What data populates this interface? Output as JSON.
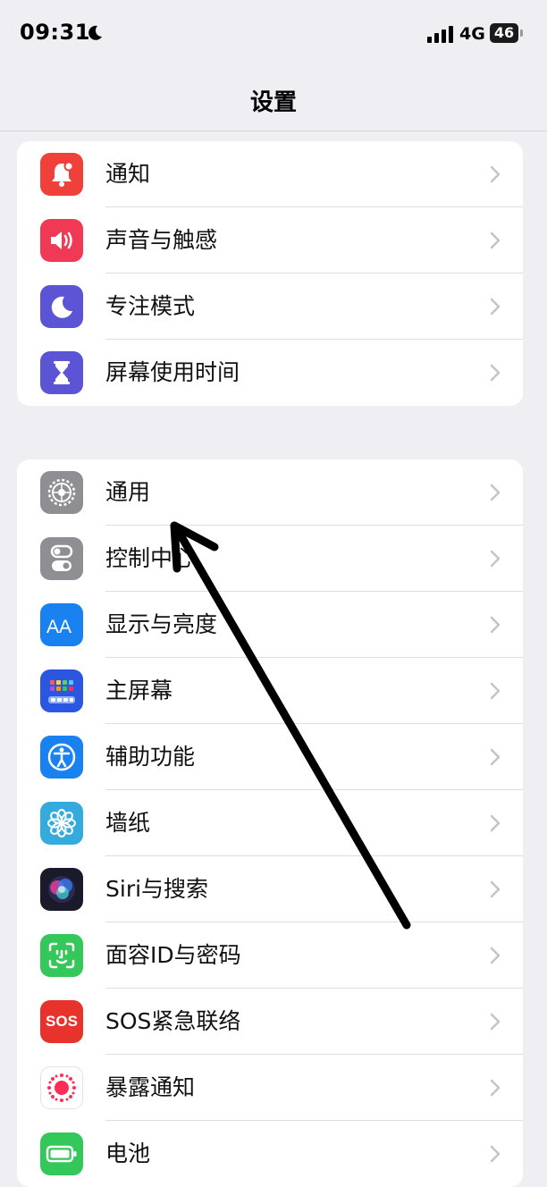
{
  "status": {
    "time": "09:31",
    "network": "4G",
    "battery": "46"
  },
  "nav": {
    "title": "设置"
  },
  "group1": [
    {
      "label": "通知",
      "icon": "notification-bell-icon",
      "color": "#f0403a"
    },
    {
      "label": "声音与触感",
      "icon": "speaker-icon",
      "color": "#f03a55"
    },
    {
      "label": "专注模式",
      "icon": "moon-icon",
      "color": "#5b55d6"
    },
    {
      "label": "屏幕使用时间",
      "icon": "hourglass-icon",
      "color": "#5b55d6"
    }
  ],
  "group2": [
    {
      "label": "通用",
      "icon": "gear-icon",
      "color": "#8e8e93"
    },
    {
      "label": "控制中心",
      "icon": "toggles-icon",
      "color": "#8e8e93"
    },
    {
      "label": "显示与亮度",
      "icon": "text-size-icon",
      "color": "#1a82f0"
    },
    {
      "label": "主屏幕",
      "icon": "home-grid-icon",
      "color": "#2a56e0"
    },
    {
      "label": "辅助功能",
      "icon": "accessibility-icon",
      "color": "#1a82f0"
    },
    {
      "label": "墙纸",
      "icon": "flower-icon",
      "color": "#35aadc"
    },
    {
      "label": "Siri与搜索",
      "icon": "siri-icon",
      "color": "#1a1a2a"
    },
    {
      "label": "面容ID与密码",
      "icon": "face-id-icon",
      "color": "#34c759"
    },
    {
      "label": "SOS紧急联络",
      "icon": "sos-icon",
      "color": "#e8332c"
    },
    {
      "label": "暴露通知",
      "icon": "exposure-icon",
      "color": "#ffffff"
    },
    {
      "label": "电池",
      "icon": "battery-icon",
      "color": "#34c759"
    }
  ],
  "sos_icon_text": "SOS"
}
